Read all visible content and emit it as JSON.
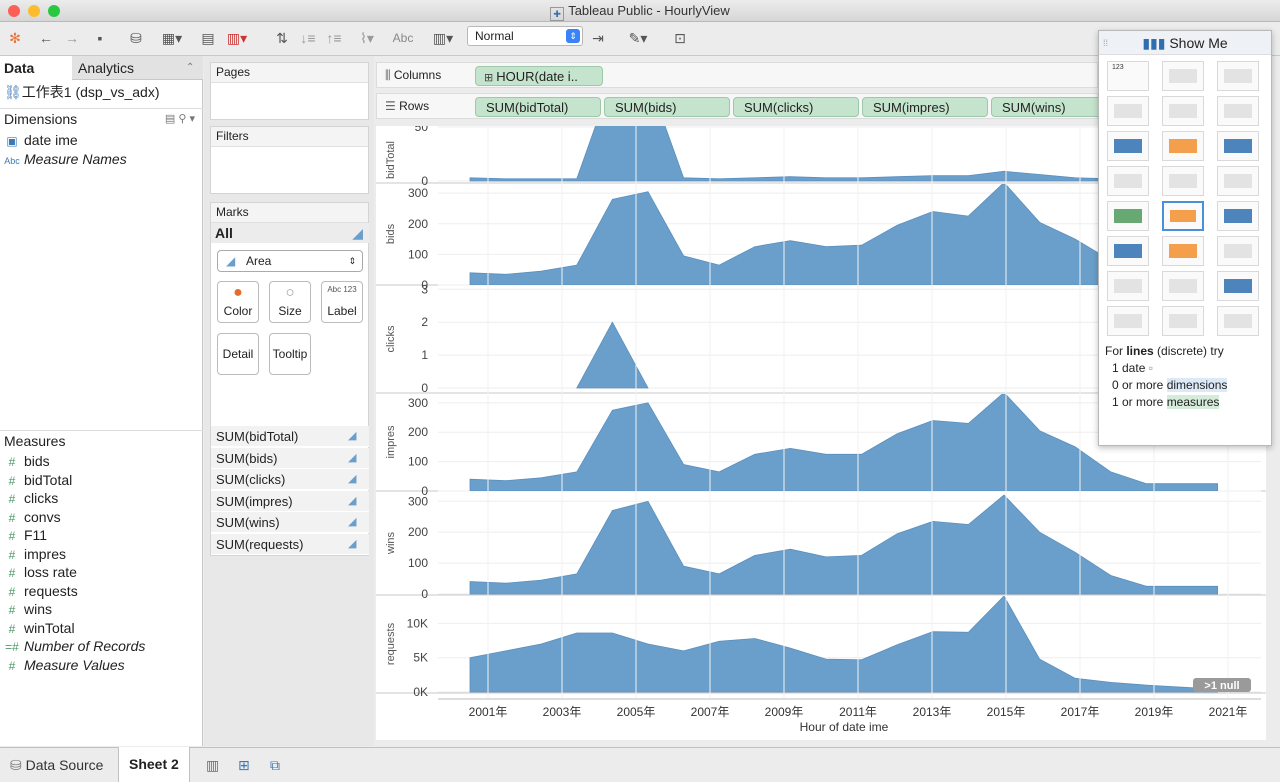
{
  "window": {
    "title": "Tableau Public - HourlyView"
  },
  "toolbar": {
    "fit": "Normal",
    "text_icon": "Abc"
  },
  "data_pane": {
    "tabs": [
      "Data",
      "Analytics"
    ],
    "datasource": "工作表1 (dsp_vs_adx)",
    "dimensions_header": "Dimensions",
    "dimensions": [
      {
        "name": "date ime",
        "kind": "date"
      },
      {
        "name": "Measure Names",
        "kind": "abc"
      }
    ],
    "measures_header": "Measures",
    "measures": [
      "bids",
      "bidTotal",
      "clicks",
      "convs",
      "F11",
      "impres",
      "loss rate",
      "requests",
      "wins",
      "winTotal",
      "Number of Records",
      "Measure Values"
    ]
  },
  "cards": {
    "pages": "Pages",
    "filters": "Filters",
    "marks": "Marks",
    "marks_all": "All",
    "mark_type": "Area",
    "mark_buttons": [
      "Color",
      "Size",
      "Label",
      "Detail",
      "Tooltip"
    ],
    "label_icon_text": "Abc 123",
    "mark_fields": [
      "SUM(bidTotal)",
      "SUM(bids)",
      "SUM(clicks)",
      "SUM(impres)",
      "SUM(wins)",
      "SUM(requests)"
    ]
  },
  "shelves": {
    "columns_label": "Columns",
    "rows_label": "Rows",
    "columns": [
      "HOUR(date i.."
    ],
    "rows": [
      "SUM(bidTotal)",
      "SUM(bids)",
      "SUM(clicks)",
      "SUM(impres)",
      "SUM(wins)"
    ]
  },
  "show_me": {
    "title": "Show Me",
    "hint_prefix": "For ",
    "hint_bold": "lines",
    "hint_suffix": " (discrete) try",
    "hint_lines": [
      "1 date",
      "0 or more ",
      "1 or more "
    ],
    "hint_dims": "dimensions",
    "hint_meas": "measures",
    "table_cell_text": "123"
  },
  "bottom": {
    "tabs": [
      "Data Source",
      "Sheet 2"
    ]
  },
  "chart_data": {
    "type": "area",
    "xlabel": "Hour of date ime",
    "x_ticks": [
      "2001年",
      "2003年",
      "2005年",
      "2007年",
      "2009年",
      "2011年",
      "2013年",
      "2015年",
      "2017年",
      "2019年",
      "2021年"
    ],
    "x": [
      0,
      1,
      2,
      3,
      4,
      5,
      6,
      7,
      8,
      9,
      10,
      11,
      12,
      13,
      14,
      15,
      16,
      17,
      18,
      19,
      20,
      21
    ],
    "null_badge": ">1 null",
    "color": "#6a9fcb",
    "panels": [
      {
        "ylabel": "bidTotal",
        "ticks": [
          {
            "v": 0,
            "t": "0"
          },
          {
            "v": 50,
            "t": "50"
          }
        ],
        "ylim": [
          0,
          62
        ],
        "values": [
          3,
          2,
          2,
          2,
          95,
          95,
          3,
          2,
          3,
          4,
          3,
          3,
          4,
          5,
          5,
          9,
          6,
          3,
          2,
          2,
          2,
          2
        ]
      },
      {
        "ylabel": "bids",
        "ticks": [
          {
            "v": 0,
            "t": "0"
          },
          {
            "v": 100,
            "t": "100"
          },
          {
            "v": 200,
            "t": "200"
          },
          {
            "v": 300,
            "t": "300"
          }
        ],
        "ylim": [
          0,
          330
        ],
        "values": [
          40,
          35,
          45,
          65,
          280,
          305,
          95,
          65,
          125,
          145,
          125,
          130,
          195,
          240,
          225,
          335,
          205,
          150,
          80,
          50,
          25,
          25
        ]
      },
      {
        "ylabel": "clicks",
        "ticks": [
          {
            "v": 0,
            "t": "0"
          },
          {
            "v": 1,
            "t": "1"
          },
          {
            "v": 2,
            "t": "2"
          },
          {
            "v": 3,
            "t": "3"
          }
        ],
        "ylim": [
          0,
          3.1
        ],
        "values": [
          null,
          null,
          null,
          0,
          2,
          0,
          null,
          null,
          null,
          null,
          null,
          null,
          null,
          null,
          null,
          null,
          null,
          null,
          null,
          null,
          null,
          null
        ]
      },
      {
        "ylabel": "impres",
        "ticks": [
          {
            "v": 0,
            "t": "0"
          },
          {
            "v": 100,
            "t": "100"
          },
          {
            "v": 200,
            "t": "200"
          },
          {
            "v": 300,
            "t": "300"
          }
        ],
        "ylim": [
          0,
          330
        ],
        "values": [
          40,
          35,
          45,
          65,
          275,
          300,
          90,
          65,
          125,
          145,
          125,
          125,
          195,
          240,
          230,
          335,
          205,
          150,
          65,
          25,
          25,
          25
        ]
      },
      {
        "ylabel": "wins",
        "ticks": [
          {
            "v": 0,
            "t": "0"
          },
          {
            "v": 100,
            "t": "100"
          },
          {
            "v": 200,
            "t": "200"
          },
          {
            "v": 300,
            "t": "300"
          }
        ],
        "ylim": [
          0,
          330
        ],
        "values": [
          40,
          35,
          45,
          65,
          270,
          300,
          90,
          65,
          125,
          145,
          120,
          125,
          195,
          235,
          225,
          320,
          200,
          135,
          60,
          25,
          25,
          25
        ]
      },
      {
        "ylabel": "requests",
        "ticks": [
          {
            "v": 0,
            "t": "0K"
          },
          {
            "v": 5000,
            "t": "5K"
          },
          {
            "v": 10000,
            "t": "10K"
          }
        ],
        "ylim": [
          0,
          14000
        ],
        "values": [
          5000,
          6000,
          7000,
          8600,
          8600,
          7000,
          6000,
          7400,
          7800,
          6400,
          4800,
          4700,
          6900,
          8800,
          8700,
          14000,
          4800,
          2000,
          1400,
          1000,
          700,
          400
        ]
      }
    ]
  }
}
